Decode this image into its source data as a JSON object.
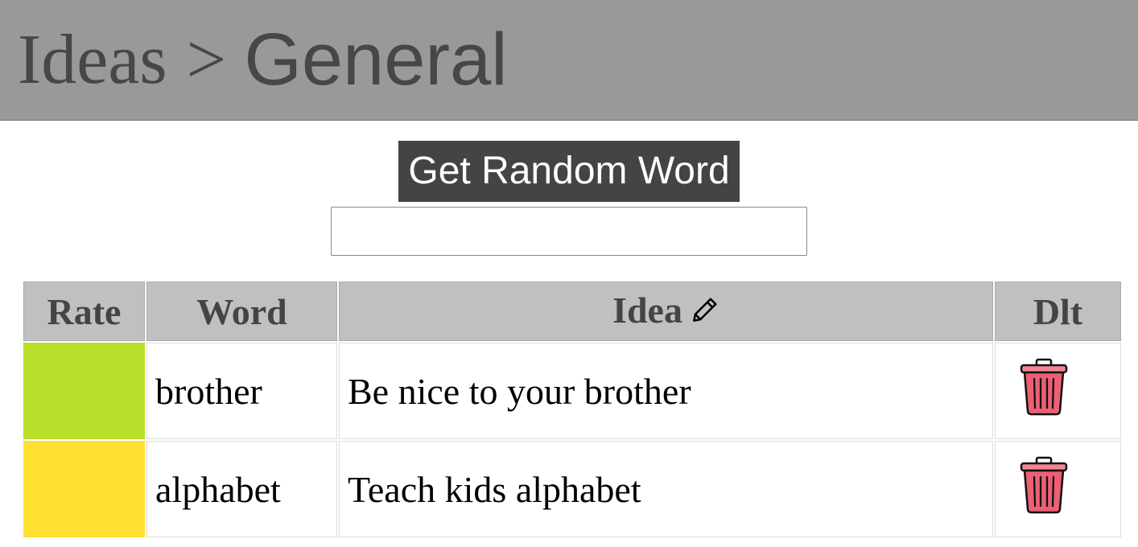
{
  "header": {
    "root": "Ideas",
    "separator": ">",
    "current": "General"
  },
  "controls": {
    "random_button_label": "Get Random Word",
    "random_word_value": ""
  },
  "table": {
    "columns": {
      "rate": "Rate",
      "word": "Word",
      "idea": "Idea",
      "delete": "Dlt"
    },
    "rows": [
      {
        "rate_color": "#b8df2a",
        "word": "brother",
        "idea": "Be nice to your brother"
      },
      {
        "rate_color": "#ffe033",
        "word": "alphabet",
        "idea": "Teach kids alphabet"
      }
    ]
  },
  "colors": {
    "header_bg": "#999999",
    "button_bg": "#444444",
    "th_bg": "#c0c0c0",
    "trash_fill": "#ec5f74",
    "trash_lid": "#f08595"
  },
  "icons": {
    "edit": "pencil-icon",
    "delete": "trash-icon"
  }
}
